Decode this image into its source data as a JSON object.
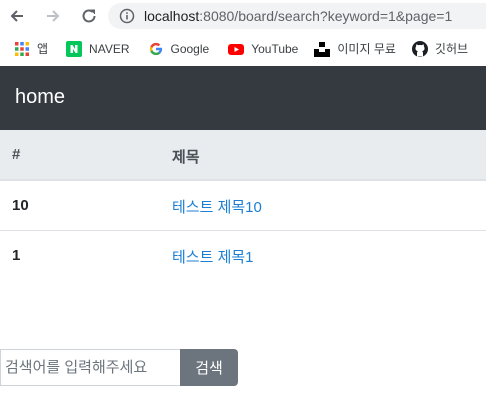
{
  "browser": {
    "url_host": "localhost",
    "url_path": ":8080/board/search?keyword=1&page=1"
  },
  "bookmarks": [
    {
      "label": "앱",
      "icon": "apps-grid-icon"
    },
    {
      "label": "NAVER",
      "icon": "naver-icon"
    },
    {
      "label": "Google",
      "icon": "google-icon"
    },
    {
      "label": "YouTube",
      "icon": "youtube-icon"
    },
    {
      "label": "이미지 무료",
      "icon": "unsplash-icon"
    },
    {
      "label": "깃허브",
      "icon": "github-icon"
    }
  ],
  "navbar": {
    "brand": "home"
  },
  "table": {
    "headers": [
      "#",
      "제목"
    ],
    "rows": [
      {
        "num": "10",
        "title": "테스트 제목10"
      },
      {
        "num": "1",
        "title": "테스트 제목1"
      }
    ]
  },
  "search": {
    "placeholder": "검색어를 입력해주세요",
    "button_label": "검색"
  },
  "colors": {
    "navbar_bg": "#343a40",
    "table_head_bg": "#e9ecef",
    "link": "#1a7fd4",
    "button_bg": "#6c757d"
  }
}
